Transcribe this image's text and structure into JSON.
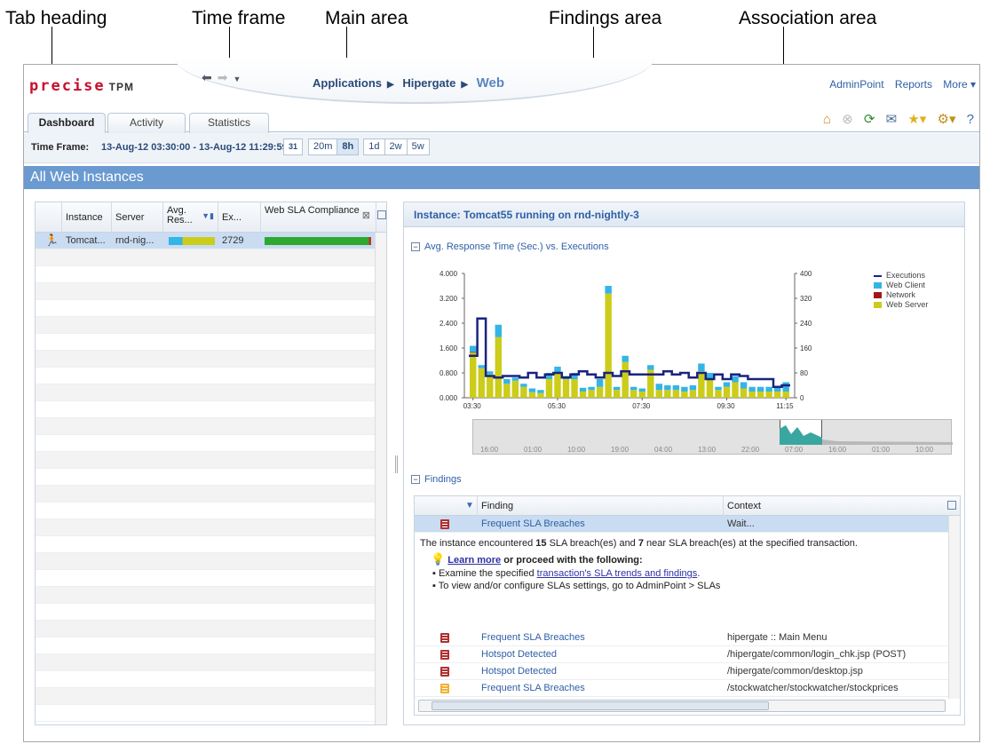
{
  "callouts": {
    "tab_heading": "Tab heading",
    "time_frame": "Time frame",
    "main_area": "Main area",
    "findings_area": "Findings area",
    "association_area": "Association area"
  },
  "logo": {
    "brand": "precise",
    "product": "TPM"
  },
  "breadcrumb": [
    "Applications",
    "Hipergate",
    "Web"
  ],
  "top_links": [
    "AdminPoint",
    "Reports",
    "More ▾"
  ],
  "tabs": [
    "Dashboard",
    "Activity",
    "Statistics"
  ],
  "time_frame": {
    "label": "Time Frame:",
    "value": "13-Aug-12 03:30:00 - 13-Aug-12 11:29:59",
    "calendar": "31",
    "options": [
      "20m",
      "8h",
      "1d",
      "2w",
      "5w"
    ],
    "selected": "8h"
  },
  "heading": "All Web Instances",
  "instances_table": {
    "columns": [
      "Instance",
      "Server",
      "Avg. Res...",
      "Ex...",
      "Web SLA Compliance"
    ],
    "rows": [
      {
        "instance": "Tomcat...",
        "server": "rnd-nig...",
        "avg_response": "",
        "executions": "2729",
        "sla": ""
      }
    ]
  },
  "instance_title": "Instance: Tomcat55 running on rnd-nightly-3",
  "chart_section": "Avg. Response Time (Sec.) vs. Executions",
  "chart_data": {
    "type": "bar",
    "categories": [
      "03:30",
      "",
      "",
      "",
      "",
      "",
      "",
      "",
      "",
      "",
      "05:30",
      "",
      "",
      "",
      "",
      "",
      "",
      "",
      "",
      "",
      "07:30",
      "",
      "",
      "",
      "",
      "",
      "",
      "",
      "",
      "",
      "09:30",
      "",
      "",
      "",
      "",
      "",
      "",
      "",
      "",
      "",
      "11:15"
    ],
    "series": [
      {
        "name": "Web Server",
        "color": "#cccc1a",
        "values": [
          1.45,
          0.95,
          0.75,
          1.95,
          0.45,
          0.55,
          0.35,
          0.18,
          0.15,
          0.6,
          0.8,
          0.6,
          0.6,
          0.2,
          0.25,
          0.35,
          3.35,
          0.25,
          1.15,
          0.25,
          0.2,
          0.9,
          0.25,
          0.25,
          0.25,
          0.2,
          0.25,
          0.85,
          0.6,
          0.25,
          0.35,
          0.5,
          0.3,
          0.2,
          0.2,
          0.2,
          0.2,
          0.2
        ]
      },
      {
        "name": "Network",
        "color": "#a01818",
        "values": [
          0.02,
          0.0,
          0.0,
          0.0,
          0.0,
          0.0,
          0.0,
          0.0,
          0.0,
          0.0,
          0.0,
          0.0,
          0.0,
          0.0,
          0.0,
          0.0,
          0.0,
          0.0,
          0.0,
          0.0,
          0.0,
          0.0,
          0.0,
          0.0,
          0.0,
          0.0,
          0.0,
          0.0,
          0.0,
          0.0,
          0.0,
          0.0,
          0.0,
          0.0,
          0.0,
          0.0,
          0.0,
          0.0
        ]
      },
      {
        "name": "Web Client",
        "color": "#33b5e5",
        "values": [
          0.2,
          0.1,
          0.1,
          0.4,
          0.15,
          0.1,
          0.1,
          0.12,
          0.1,
          0.2,
          0.2,
          0.1,
          0.2,
          0.12,
          0.1,
          0.25,
          0.25,
          0.1,
          0.2,
          0.1,
          0.1,
          0.15,
          0.2,
          0.15,
          0.15,
          0.15,
          0.15,
          0.25,
          0.2,
          0.1,
          0.15,
          0.2,
          0.2,
          0.15,
          0.15,
          0.15,
          0.15,
          0.3
        ]
      },
      {
        "name": "Executions",
        "color": "#1a237e",
        "values": [
          135,
          255,
          70,
          65,
          70,
          70,
          65,
          80,
          65,
          75,
          80,
          65,
          75,
          85,
          75,
          65,
          80,
          70,
          85,
          75,
          75,
          75,
          75,
          85,
          75,
          80,
          65,
          80,
          60,
          75,
          60,
          75,
          70,
          60,
          60,
          60,
          35,
          40
        ]
      }
    ],
    "y_left_ticks": [
      "4.000",
      "3.200",
      "2.400",
      "1.600",
      "0.800",
      "0.000"
    ],
    "y_right_ticks": [
      "400",
      "320",
      "240",
      "160",
      "80",
      "0"
    ],
    "x_ticks": [
      "03:30",
      "05:30",
      "07:30",
      "09:30",
      "11:15"
    ],
    "ylim": [
      0,
      4
    ],
    "y2lim": [
      0,
      400
    ],
    "legend": [
      "Executions",
      "Web Client",
      "Network",
      "Web Server"
    ],
    "legend_position": "right"
  },
  "overview": {
    "ticks": [
      "16:00",
      "01:00",
      "10:00",
      "19:00",
      "04:00",
      "13:00",
      "22:00",
      "07:00",
      "16:00",
      "01:00",
      "10:00"
    ]
  },
  "findings": {
    "section": "Findings",
    "columns": [
      "Finding",
      "Context"
    ],
    "rows": [
      {
        "severity": "high",
        "finding": "Frequent SLA Breaches",
        "context": "Wait..."
      },
      {
        "severity": "high",
        "finding": "Frequent SLA Breaches",
        "context": "hipergate :: Main Menu"
      },
      {
        "severity": "high",
        "finding": "Hotspot Detected",
        "context": "/hipergate/common/login_chk.jsp (POST)"
      },
      {
        "severity": "high",
        "finding": "Hotspot Detected",
        "context": "/hipergate/common/desktop.jsp"
      },
      {
        "severity": "medium",
        "finding": "Frequent SLA Breaches",
        "context": "/stockwatcher/stockwatcher/stockprices"
      }
    ],
    "detail": {
      "text_pre": "The instance encountered ",
      "breaches": "15",
      "text_mid": " SLA breach(es) and ",
      "near": "7",
      "text_post": " near SLA breach(es) at the specified transaction.",
      "learn_more": "Learn more",
      "learn_suffix": " or proceed with the following:",
      "bullet1_pre": "Examine the specified ",
      "bullet1_link": "transaction's SLA trends and findings",
      "bullet1_post": ".",
      "bullet2": "To view and/or configure SLAs settings, go to AdminPoint > SLAs"
    }
  },
  "colors": {
    "header_blue": "#6a9ad0",
    "link_blue": "#2f5fa6",
    "severity_high": "#b03030",
    "severity_medium": "#f0b030"
  }
}
